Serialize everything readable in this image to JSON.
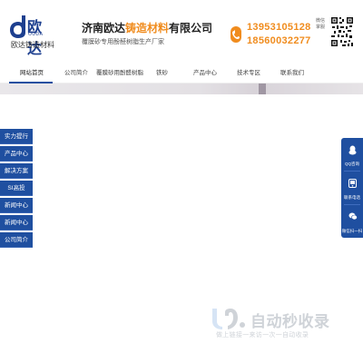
{
  "header": {
    "logo_brand": "欧达",
    "logo_sub": "OUDA",
    "logo_caption": "欧达铸造材料",
    "company_prefix": "济南欧达",
    "company_highlight": "铸造材料",
    "company_suffix": "有限公司",
    "slogan": "覆膜砂专用酚醛树脂生产厂家",
    "phone1": "13953105128",
    "phone2": "18560032277",
    "qr_label": "微信掌服"
  },
  "nav": {
    "items": [
      {
        "label": "网站首页",
        "active": true
      },
      {
        "label": "公司简介"
      },
      {
        "label": "覆膜砂用酚醛树脂"
      },
      {
        "label": "铁砂"
      },
      {
        "label": "产品中心"
      },
      {
        "label": "技术专区"
      },
      {
        "label": "联系我们"
      }
    ]
  },
  "side_menu": {
    "items": [
      "实力提行",
      "产品中心",
      "解决方案",
      "SI高投",
      "新闻中心",
      "新闻中心",
      "公司简介"
    ]
  },
  "float_panel": {
    "items": [
      {
        "label": "QQ咨询",
        "icon": "qq-icon"
      },
      {
        "label": "联系电话",
        "icon": "phone-icon"
      },
      {
        "label": "微信扫一扫",
        "icon": "wechat-icon"
      }
    ]
  },
  "watermark": {
    "title": "自动秒收录",
    "subtitle": "做上链接一来访一次一自动收录"
  },
  "colors": {
    "brand_blue": "#1f4fa0",
    "accent_orange": "#f08c1e"
  }
}
